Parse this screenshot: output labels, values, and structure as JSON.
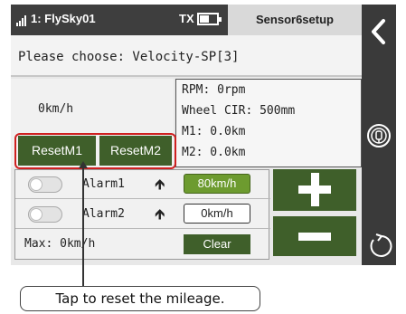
{
  "status_bar": {
    "model_name": "1: FlySky01",
    "tx_label": "TX",
    "screen_title": "Sensor6setup"
  },
  "prompt": {
    "text": "Please choose: Velocity-SP[3]"
  },
  "speed": {
    "value": "0km/h"
  },
  "info": {
    "rpm": "RPM: 0rpm",
    "wheel_cir": "Wheel CIR: 500mm",
    "m1": "M1: 0.0km",
    "m2": "M2: 0.0km"
  },
  "reset": {
    "m1_label": "ResetM1",
    "m2_label": "ResetM2"
  },
  "alarms": {
    "alarm1_label": "Alarm1",
    "alarm1_value": "80km/h",
    "alarm1_enabled": false,
    "alarm2_label": "Alarm2",
    "alarm2_value": "0km/h",
    "alarm2_enabled": false,
    "max_label": "Max: 0km/h",
    "clear_label": "Clear"
  },
  "icons": {
    "signal": "signal-bars-icon",
    "battery": "battery-icon",
    "back": "chevron-left-icon",
    "bind": "bind-icon",
    "rotate": "rotate-icon",
    "plus": "plus-icon",
    "minus": "minus-icon",
    "up_arrow": "arrow-up-icon"
  },
  "colors": {
    "button_green": "#3f5f2a",
    "active_value_green": "#6d9b2f",
    "highlight_red": "#cf2020",
    "status_bar": "#3e3e3e"
  },
  "annotation": {
    "callout_text": "Tap to reset the mileage."
  }
}
